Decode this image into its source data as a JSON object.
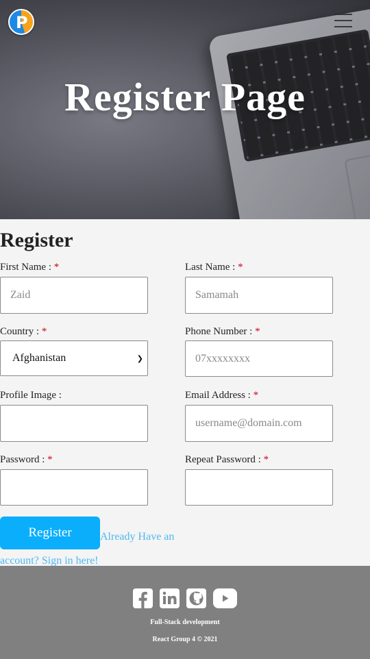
{
  "hero": {
    "title": "Register Page"
  },
  "form": {
    "title": "Register",
    "required_mark": "*",
    "first_name": {
      "label": "First Name :",
      "value": "Zaid"
    },
    "last_name": {
      "label": "Last Name :",
      "value": "Samamah"
    },
    "country": {
      "label": "Country :",
      "selected": "Afghanistan"
    },
    "phone": {
      "label": "Phone Number :",
      "placeholder": "07xxxxxxxx"
    },
    "profile_image": {
      "label": "Profile Image :"
    },
    "email": {
      "label": "Email Address :",
      "placeholder": "username@domain.com"
    },
    "password": {
      "label": "Password :"
    },
    "repeat_password": {
      "label": "Repeat Password :"
    },
    "submit_label": "Register",
    "signin_text": "Already Have an account? Sign in here!"
  },
  "footer": {
    "social": [
      "facebook-icon",
      "linkedin-icon",
      "github-icon",
      "youtube-icon"
    ],
    "tagline": "Full-Stack development",
    "copyright": "React Group 4 © 2021"
  },
  "colors": {
    "accent": "#0aaefb",
    "link": "#4fb8ef",
    "required": "#d0021b",
    "footer_bg": "#808080"
  }
}
